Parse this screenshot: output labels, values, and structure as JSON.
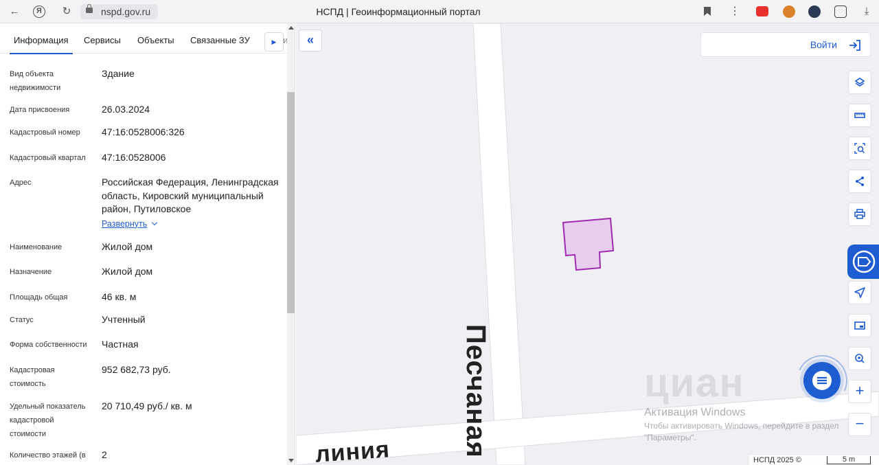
{
  "browser": {
    "url": "nspd.gov.ru",
    "title": "НСПД | Геоинформационный портал"
  },
  "tabs": [
    "Информация",
    "Сервисы",
    "Объекты",
    "Связанные ЗУ"
  ],
  "tab_overflow": "и",
  "info": [
    {
      "label": "Вид объекта недвижимости",
      "value": "Здание"
    },
    {
      "label": "Дата присвоения",
      "value": "26.03.2024"
    },
    {
      "label": "Кадастровый номер",
      "value": "47:16:0528006:326"
    },
    {
      "label": "Кадастровый квартал",
      "value": "47:16:0528006"
    },
    {
      "label": "Адрес",
      "value": "Российская Федерация, Ленинградская область, Кировский муниципальный район, Путиловское",
      "expand": "Развернуть"
    },
    {
      "label": "Наименование",
      "value": "Жилой дом"
    },
    {
      "label": "Назначение",
      "value": "Жилой дом"
    },
    {
      "label": "Площадь общая",
      "value": "46 кв. м"
    },
    {
      "label": "Статус",
      "value": "Учтенный"
    },
    {
      "label": "Форма собственности",
      "value": "Частная"
    },
    {
      "label": "Кадастровая стоимость",
      "value": "952 682,73 руб."
    },
    {
      "label": "Удельный показатель кадастровой стоимости",
      "value": "20 710,49 руб./ кв. м"
    },
    {
      "label": "Количество этажей (в",
      "value": "2"
    }
  ],
  "map": {
    "login_label": "Войти",
    "street_vertical": "Песчаная",
    "street_horizontal": "линия",
    "watermark": "циан",
    "activation_title": "Активация Windows",
    "activation_text": "Чтобы активировать Windows, перейдите в раздел \"Параметры\".",
    "footer_copy": "НСПД 2025 ©",
    "scale_label": "5 m",
    "parcel_fill": "#e8cdef",
    "parcel_stroke": "#a02ab0"
  },
  "colors": {
    "accent": "#1d5cd1"
  }
}
